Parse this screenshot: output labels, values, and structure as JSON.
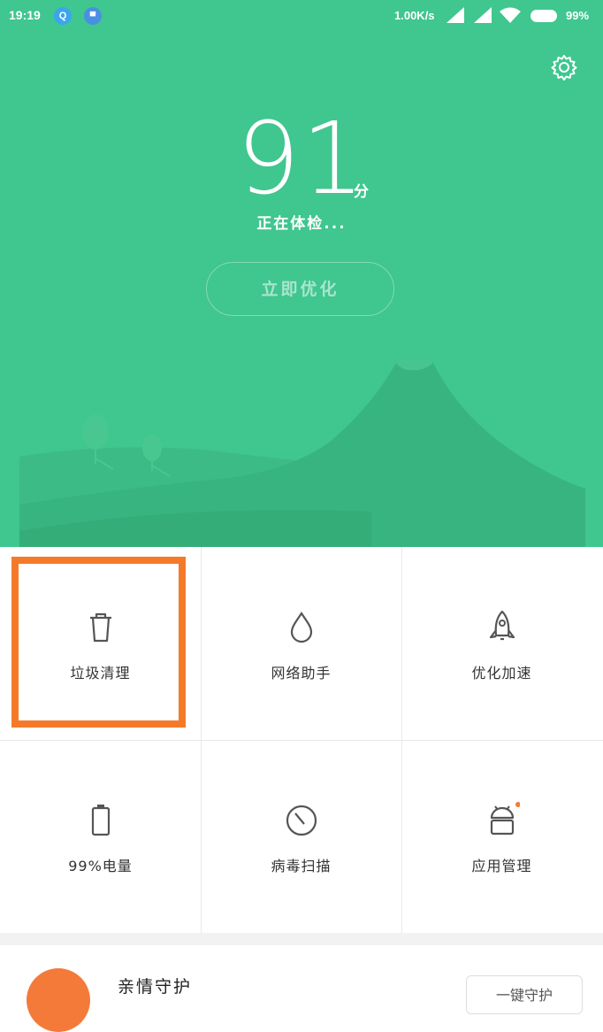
{
  "status_bar": {
    "time": "19:19",
    "app_icon_1": "Q",
    "speed": "1.00K/s",
    "battery_percent": "99%"
  },
  "header": {
    "score": "91",
    "score_unit": "分",
    "status_text": "正在体检...",
    "optimize_button": "立即优化",
    "settings_icon": "gear-icon",
    "background_color": "#40c68f"
  },
  "tools": [
    {
      "label": "垃圾清理",
      "icon": "trash-icon"
    },
    {
      "label": "网络助手",
      "icon": "droplet-icon"
    },
    {
      "label": "优化加速",
      "icon": "rocket-icon"
    },
    {
      "label": "99%电量",
      "icon": "battery-icon"
    },
    {
      "label": "病毒扫描",
      "icon": "scan-icon"
    },
    {
      "label": "应用管理",
      "icon": "android-icon"
    }
  ],
  "highlight_color": "#f47a2a",
  "card": {
    "title": "亲情守护",
    "button": "一键守护"
  }
}
